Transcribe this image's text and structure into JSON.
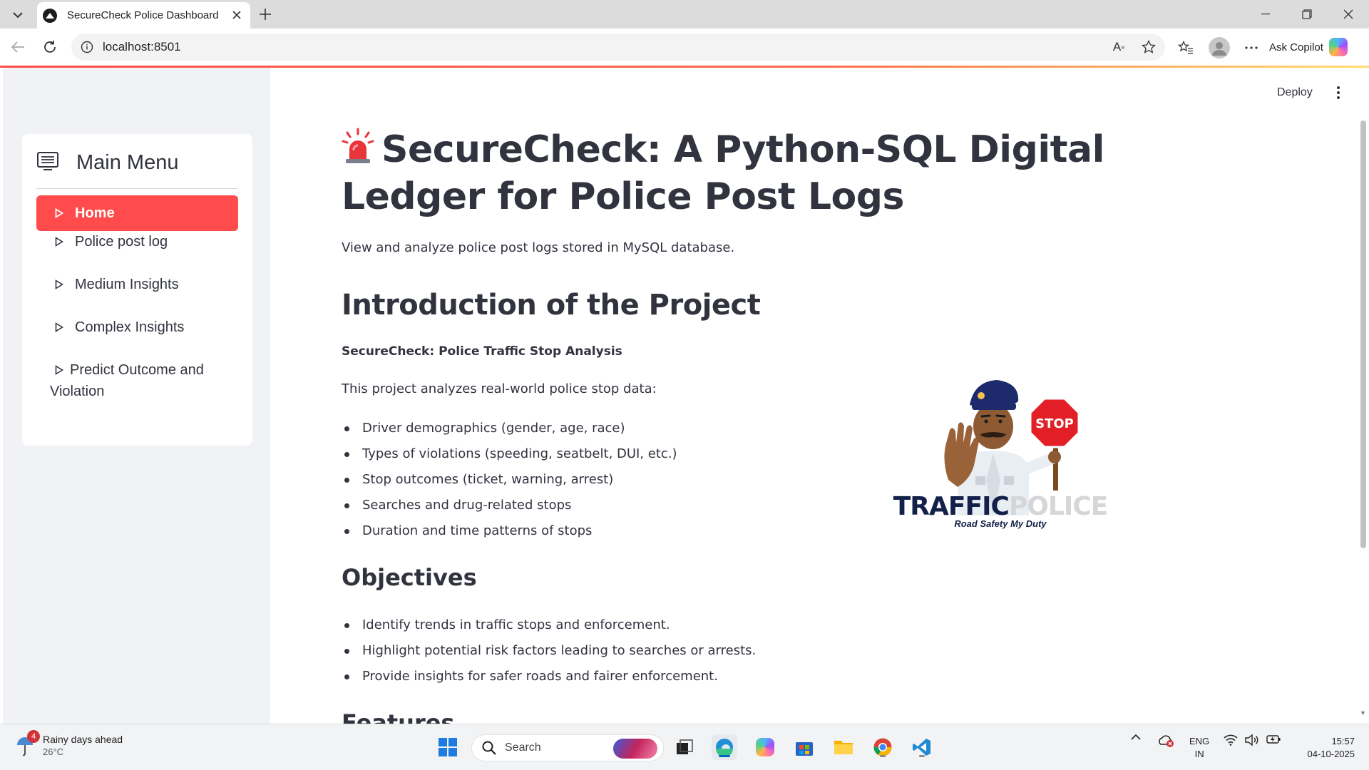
{
  "browser": {
    "tab_title": "SecureCheck Police Dashboard",
    "url": "localhost:8501",
    "copilot_label": "Ask Copilot",
    "loading_gradient": [
      "#ff4b4b",
      "#ffdd70"
    ]
  },
  "app": {
    "deploy_label": "Deploy",
    "accent_color": "#ff4b4b"
  },
  "sidebar": {
    "menu_title": "Main Menu",
    "items": [
      {
        "label": "Home",
        "active": true
      },
      {
        "label": "Police post log",
        "active": false
      },
      {
        "label": "Medium Insights",
        "active": false
      },
      {
        "label": "Complex Insights",
        "active": false
      },
      {
        "label": "Predict Outcome and Violation",
        "active": false
      }
    ]
  },
  "main": {
    "title": "SecureCheck: A Python-SQL Digital Ledger for Police Post Logs",
    "subtitle": "View and analyze police post logs stored in MySQL database.",
    "intro_heading": "Introduction of the Project",
    "intro_bold": "SecureCheck: Police Traffic Stop Analysis",
    "intro_text": "This project analyzes real-world police stop data:",
    "intro_list": [
      "Driver demographics (gender, age, race)",
      "Types of violations (speeding, seatbelt, DUI, etc.)",
      "Stop outcomes (ticket, warning, arrest)",
      "Searches and drug-related stops",
      "Duration and time patterns of stops"
    ],
    "objectives_heading": "Objectives",
    "objectives_list": [
      "Identify trends in traffic stops and enforcement.",
      "Highlight potential risk factors leading to searches or arrests.",
      "Provide insights for safer roads and fairer enforcement."
    ],
    "features_heading": "Features",
    "image": {
      "stop_sign": "STOP",
      "logo_word_1": "TRAFFIC",
      "logo_word_2": "POLICE",
      "tagline": "Road Safety My Duty"
    }
  },
  "taskbar": {
    "weather_badge": "4",
    "weather_title": "Rainy days ahead",
    "weather_temp": "26°C",
    "search_placeholder": "Search",
    "lang_1": "ENG",
    "lang_2": "IN",
    "time": "15:57",
    "date": "04-10-2025"
  }
}
